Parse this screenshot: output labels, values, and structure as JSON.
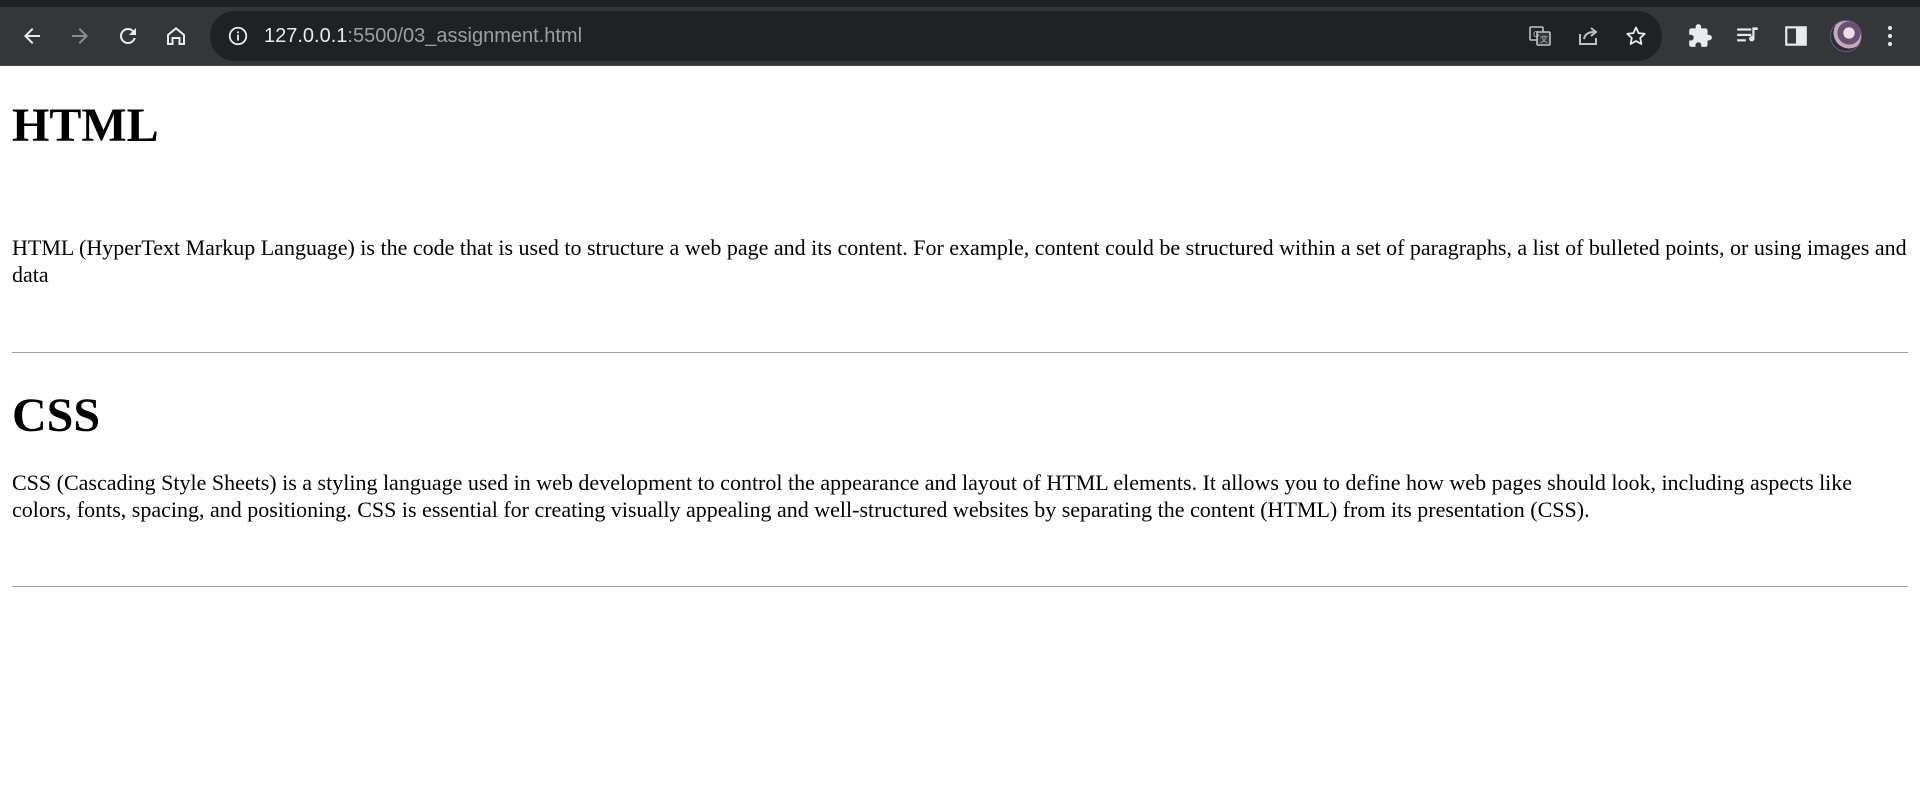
{
  "browser": {
    "url_host": "127.0.0.1",
    "url_rest": ":5500/03_assignment.html",
    "icons": {
      "back": "back-arrow-icon",
      "forward": "forward-arrow-icon",
      "reload": "reload-icon",
      "home": "home-icon",
      "site_info": "info-icon",
      "translate": "translate-icon",
      "share": "share-icon",
      "bookmark": "star-icon",
      "extensions": "puzzle-icon",
      "media": "media-queue-icon",
      "side_panel": "side-panel-icon",
      "profile": "avatar",
      "menu": "kebab-menu-icon"
    },
    "colors": {
      "toolbar": "#35363a",
      "omnibox": "#202124",
      "icon": "#e8eaed"
    }
  },
  "page": {
    "sections": [
      {
        "heading": "HTML",
        "body": "HTML (HyperText Markup Language) is the code that is used to structure a web page and its content. For example, content could be structured within a set of paragraphs, a list of bulleted points, or using images and data"
      },
      {
        "heading": "CSS",
        "body": "CSS (Cascading Style Sheets) is a styling language used in web development to control the appearance and layout of HTML elements. It allows you to define how web pages should look, including aspects like colors, fonts, spacing, and positioning. CSS is essential for creating visually appealing and well-structured websites by separating the content (HTML) from its presentation (CSS)."
      }
    ]
  }
}
